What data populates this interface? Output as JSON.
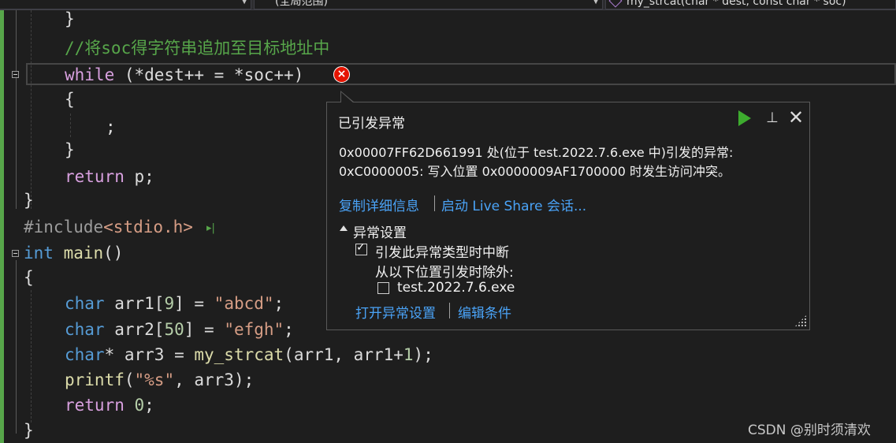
{
  "navbar": {
    "scope_dropdown": "(全局范围)",
    "member_dropdown": "my_strcat(char * dest, const char * soc)"
  },
  "code": {
    "l1_brace": "}",
    "l2_comment": "//将soc得字符串追加至目标地址中",
    "l3_while": "while",
    "l3_rest": " (*dest++ = *soc++)",
    "l4_brace": "{",
    "l5_semi": ";",
    "l6_brace": "}",
    "l7_return": "return",
    "l7_rest": " p;",
    "l8_brace": "}",
    "l9_include": "#include",
    "l9_header": "<stdio.h>",
    "l10_int": "int",
    "l10_main": " main",
    "l10_paren": "()",
    "l11_brace": "{",
    "l12_char": "char",
    "l12_a": " arr1[",
    "l12_n": "9",
    "l12_b": "] = ",
    "l12_s": "\"abcd\"",
    "l12_c": ";",
    "l13_char": "char",
    "l13_a": " arr2[",
    "l13_n": "50",
    "l13_b": "] = ",
    "l13_s": "\"efgh\"",
    "l13_c": ";",
    "l14_char": "char",
    "l14_a": "* arr3 = ",
    "l14_fn": "my_strcat",
    "l14_b": "(arr1, arr1+",
    "l14_n": "1",
    "l14_c": ");",
    "l15_fn": "printf",
    "l15_a": "(",
    "l15_s": "\"%s\"",
    "l15_b": ", arr3);",
    "l16_return": "return",
    "l16_sp": " ",
    "l16_n": "0",
    "l16_c": ";",
    "l17_brace": "}"
  },
  "popup": {
    "title": "已引发异常",
    "message_line1": "0x00007FF62D661991 处(位于 test.2022.7.6.exe 中)引发的异常:",
    "message_line2": "0xC0000005: 写入位置 0x0000009AF1700000 时发生访问冲突。",
    "copy_details": "复制详细信息",
    "live_share": "启动 Live Share 会话...",
    "settings_section": "异常设置",
    "break_checkbox_label": "引发此异常类型时中断",
    "break_checked": true,
    "except_label": "从以下位置引发时除外:",
    "exe_checkbox_label": "test.2022.7.6.exe",
    "exe_checked": false,
    "open_settings": "打开异常设置",
    "edit_conditions": "编辑条件"
  },
  "icons": {
    "error_glyph": "×",
    "exec_glyph": "▸|",
    "pin": "⊥",
    "close": "✕"
  },
  "colors": {
    "editor_bg": "#1e1e1e",
    "keyword": "#569cd6",
    "comment": "#57a64a",
    "string": "#d69d85",
    "number": "#b5cea8",
    "function": "#dcdcaa",
    "link": "#4aa3f7",
    "error": "#e51400",
    "continue": "#3dab2e"
  },
  "watermark": "CSDN @别时须清欢"
}
